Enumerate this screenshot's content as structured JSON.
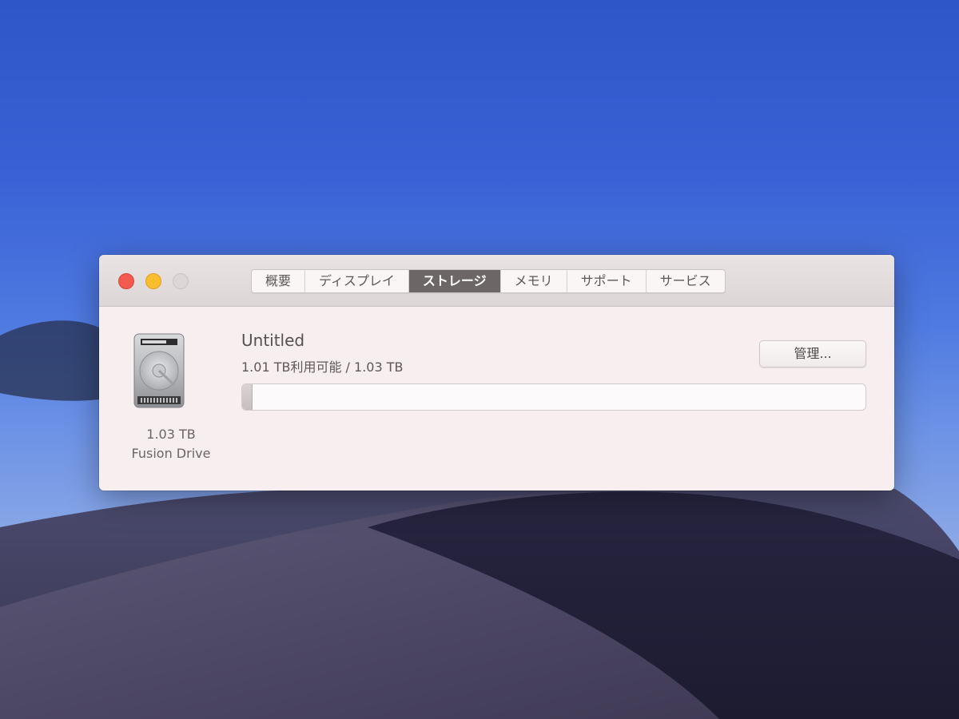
{
  "window": {
    "tabs": [
      {
        "label": "概要",
        "active": false
      },
      {
        "label": "ディスプレイ",
        "active": false
      },
      {
        "label": "ストレージ",
        "active": true
      },
      {
        "label": "メモリ",
        "active": false
      },
      {
        "label": "サポート",
        "active": false
      },
      {
        "label": "サービス",
        "active": false
      }
    ]
  },
  "storage": {
    "disk_size": "1.03 TB",
    "disk_type": "Fusion Drive",
    "volume_name": "Untitled",
    "usage_text": "1.01 TB利用可能 / 1.03 TB",
    "used_fraction": 0.016,
    "manage_label": "管理..."
  },
  "colors": {
    "close": "#f25a4f",
    "minimize": "#f8be2f",
    "zoom_disabled": "#dcd6d6",
    "active_tab": "#6c6667"
  }
}
